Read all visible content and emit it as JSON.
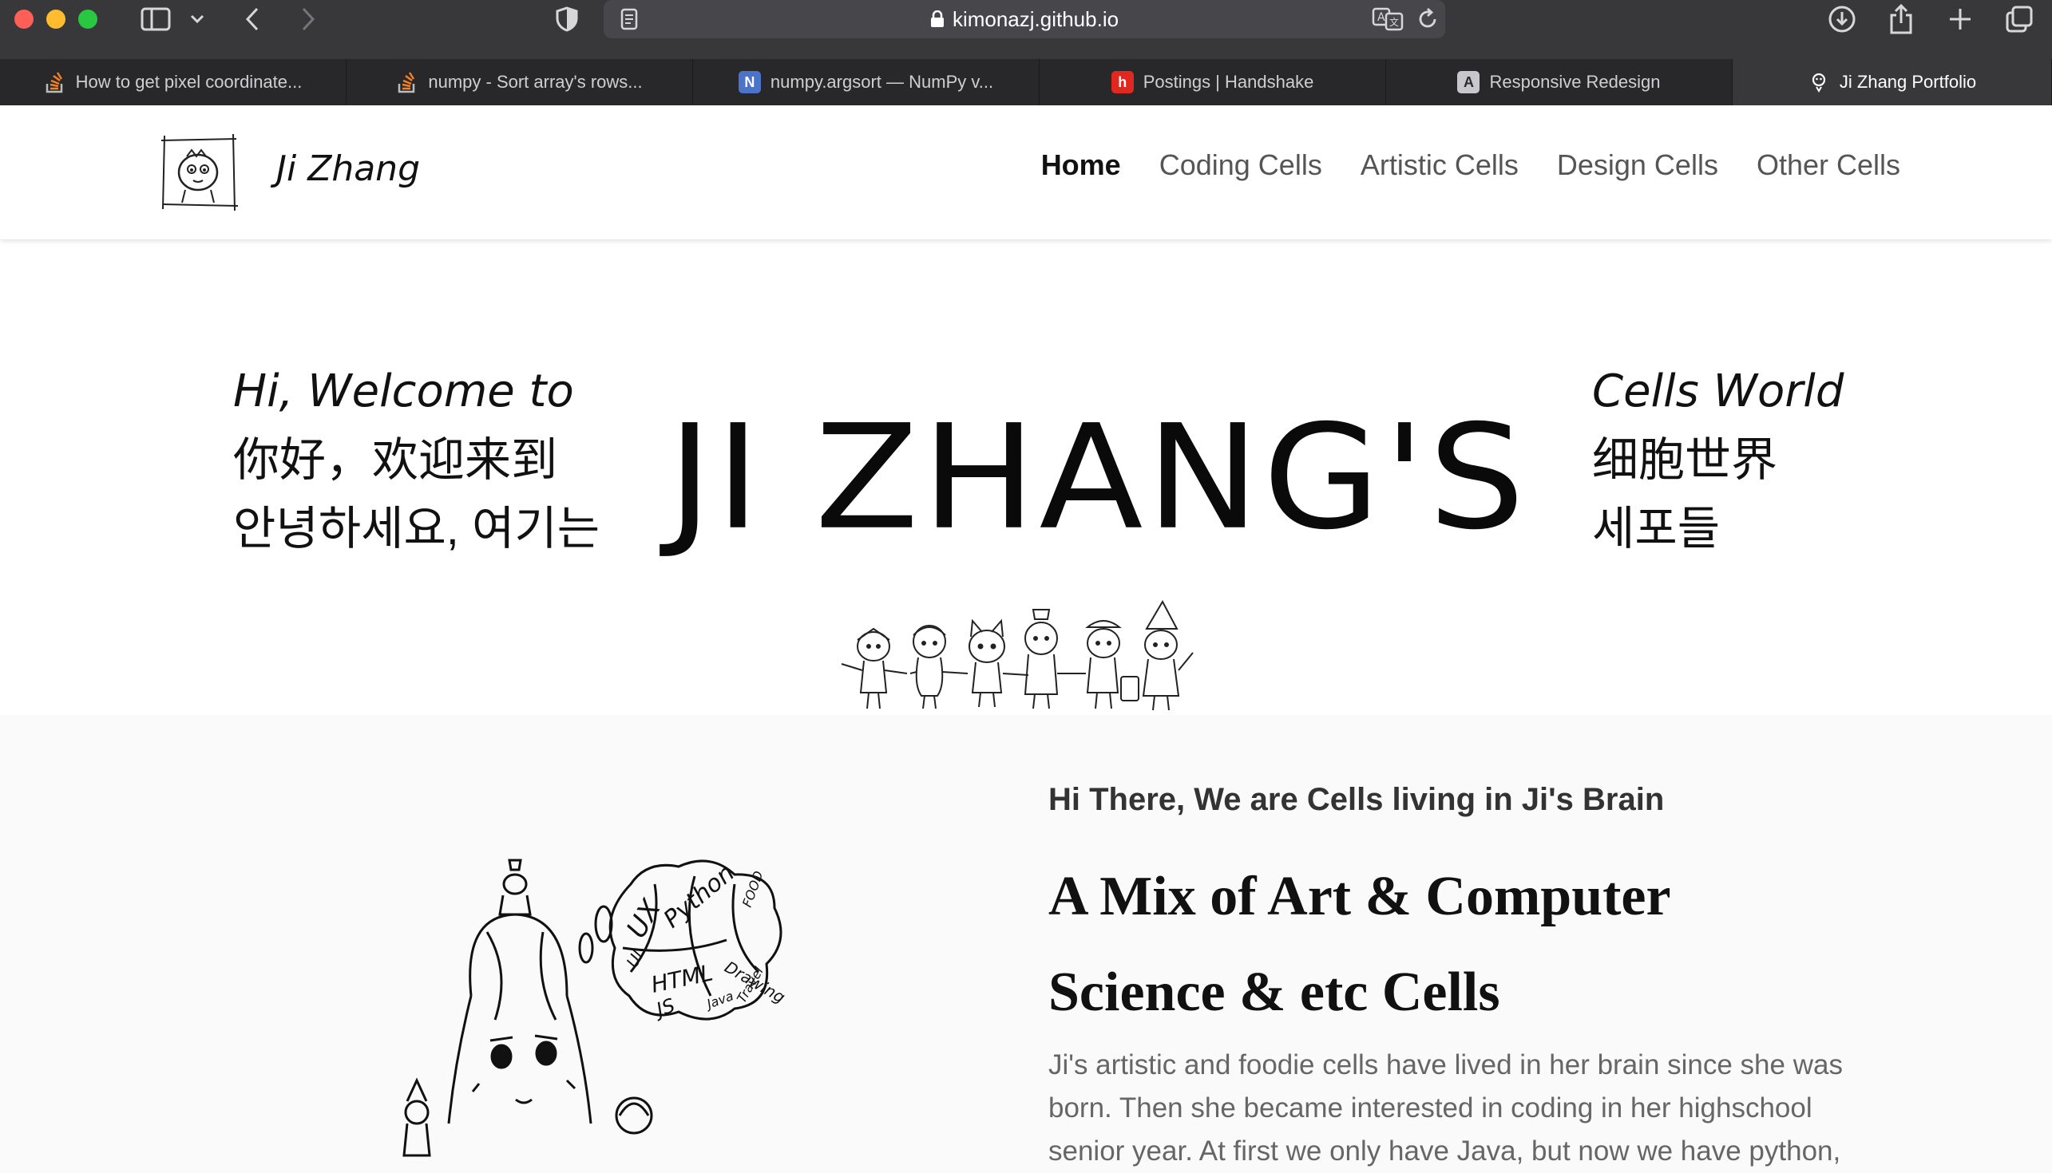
{
  "browser": {
    "url": "kimonazj.github.io",
    "tabs": [
      {
        "title": "How to get pixel coordinate...",
        "favicon": "stackoverflow-icon"
      },
      {
        "title": "numpy - Sort array's rows...",
        "favicon": "stackoverflow-icon"
      },
      {
        "title": "numpy.argsort — NumPy v...",
        "favicon": "numpy-icon"
      },
      {
        "title": "Postings | Handshake",
        "favicon": "handshake-icon"
      },
      {
        "title": "Responsive Redesign",
        "favicon": "a-icon"
      },
      {
        "title": "Ji Zhang Portfolio",
        "favicon": "portfolio-icon"
      }
    ],
    "active_tab": 5,
    "favicon_letters": {
      "numpy": "N",
      "handshake": "h",
      "a": "A"
    }
  },
  "site": {
    "brand": "Ji Zhang",
    "nav": [
      "Home",
      "Coding Cells",
      "Artistic Cells",
      "Design Cells",
      "Other Cells"
    ],
    "active_nav": "Home"
  },
  "hero": {
    "welcome_lines": [
      "Hi, Welcome to",
      "你好，欢迎来到",
      "안녕하세요, 여기는"
    ],
    "title": "JI ZHANG'S",
    "world_lines": [
      "Cells World",
      "细胞世界",
      "세포들"
    ]
  },
  "about": {
    "subtitle": "Hi There, We are Cells living in Ji's Brain",
    "title_lines": [
      "A Mix of Art & Computer",
      "Science & etc Cells"
    ],
    "body": "Ji's artistic and foodie cells have lived in her brain since she was born. Then she became interested in coding in her highschool senior year. At first we only have Java, but now we have python,",
    "brain_words": [
      "UX",
      "Python",
      "FOOD",
      "UI",
      "HTML",
      "Drawing",
      "JS",
      "Java",
      "Travel"
    ]
  }
}
